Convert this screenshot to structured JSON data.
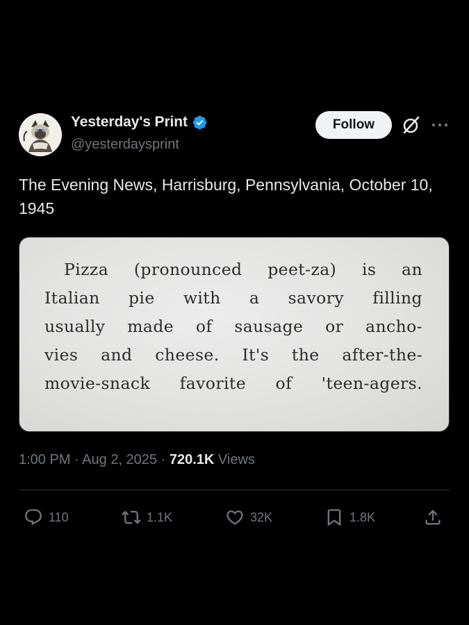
{
  "author": {
    "display_name": "Yesterday's Print",
    "handle": "@yesterdaysprint",
    "verified": true,
    "verified_color": "#1d9bf0"
  },
  "follow_label": "Follow",
  "tweet_text": "The Evening News, Harrisburg, Pennsylvania, October 10, 1945",
  "clipping": {
    "lines": [
      "Pizza (pronounced peet-za) is an",
      "Italian pie with a savory filling",
      "usually made of sausage or ancho-",
      "vies and cheese. It's the after-the-",
      "movie-snack favorite of 'teen-agers."
    ]
  },
  "meta": {
    "time": "1:00 PM",
    "separator": "·",
    "date": "Aug 2, 2025",
    "views_count": "720.1K",
    "views_label": "Views"
  },
  "actions": {
    "replies": "110",
    "reposts": "1.1K",
    "likes": "32K",
    "bookmarks": "1.8K"
  },
  "icons": {
    "verified": "verified-badge-icon",
    "grok": "grok-icon",
    "more": "more-options-icon",
    "reply": "reply-icon",
    "repost": "repost-icon",
    "like": "heart-icon",
    "bookmark": "bookmark-icon",
    "share": "share-icon"
  },
  "colors": {
    "background": "#000000",
    "text_primary": "#e7e9ea",
    "text_secondary": "#71767b",
    "follow_bg": "#eff3f4",
    "divider": "#2f3336"
  }
}
